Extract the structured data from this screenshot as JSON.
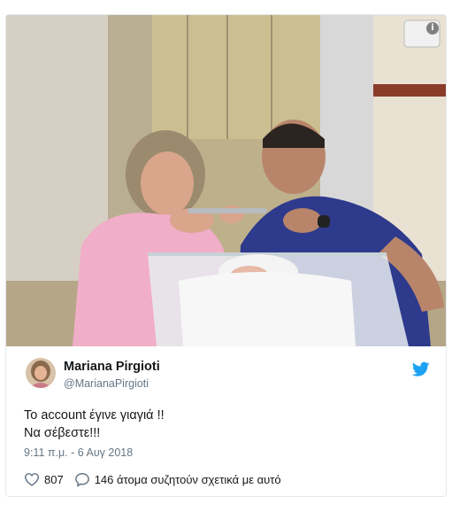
{
  "tweet": {
    "display_name": "Mariana Pirgioti",
    "handle": "@MarianaPirgioti",
    "text": "Το account έγινε γιαγιά !!\nΝα σέβεστε!!!",
    "timestamp": "9:11 π.μ. - 6 Αυγ 2018",
    "like_count": "807",
    "replies_label": "146 άτομα συζητούν σχετικά με αυτό"
  },
  "media": {
    "info_icon_label": "i"
  },
  "icons": {
    "brand": "twitter-bird-icon",
    "like": "heart-icon",
    "reply": "speech-bubble-icon",
    "info": "info-icon"
  },
  "colors": {
    "brand_blue": "#1da1f2",
    "secondary_text": "#657786",
    "primary_text": "#14171a",
    "border": "#e1e8ed"
  }
}
